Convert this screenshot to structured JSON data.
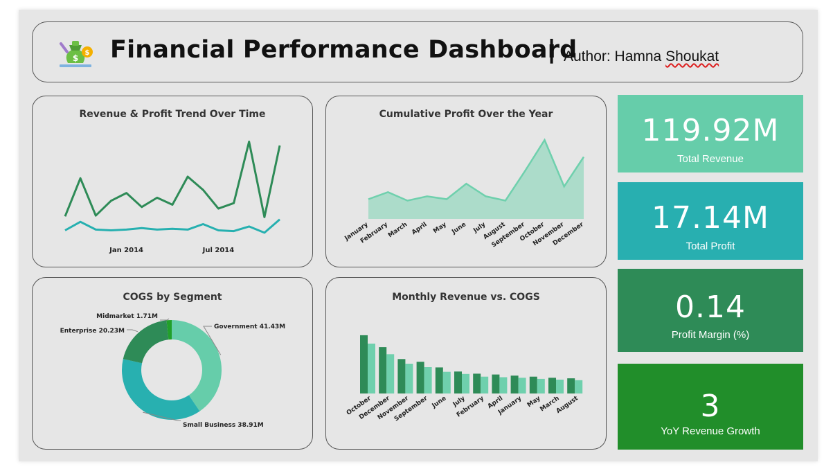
{
  "header": {
    "title": "Financial Performance Dashboard",
    "separator": "|",
    "author_prefix": "Author: Hamna ",
    "author_surname": "Shoukat"
  },
  "colors": {
    "revenue_line": "#2e8b57",
    "profit_line": "#26b0b0",
    "area_fill": "#acdcca",
    "area_line": "#6fd0ad",
    "revenue_bar": "#2e8b57",
    "cogs_bar": "#6fd0ad",
    "kpi_revenue": "#66cdaa",
    "kpi_profit": "#28afb0",
    "kpi_margin": "#2e8b57",
    "kpi_growth": "#218e2a"
  },
  "kpis": [
    {
      "value": "119.92M",
      "label": "Total Revenue"
    },
    {
      "value": "17.14M",
      "label": "Total Profit"
    },
    {
      "value": "0.14",
      "label": "Profit Margin (%)"
    },
    {
      "value": "3",
      "label": "YoY Revenue Growth"
    }
  ],
  "chart_data": [
    {
      "type": "line",
      "title": "Revenue & Profit Trend Over Time",
      "x_tick_labels": [
        "Jan 2014",
        "Jul 2014"
      ],
      "series": [
        {
          "values": [
            2.0,
            6.9,
            2.1,
            4.0,
            5.0,
            3.2,
            4.4,
            3.5,
            7.1,
            5.4,
            3.0,
            3.7,
            11.6,
            1.9,
            11.1
          ]
        },
        {
          "values": [
            0.2,
            1.3,
            0.3,
            0.2,
            0.3,
            0.5,
            0.3,
            0.4,
            0.3,
            1.0,
            0.2,
            0.1,
            0.7,
            -0.1,
            1.6
          ]
        }
      ]
    },
    {
      "type": "area",
      "title": "Cumulative Profit Over the Year",
      "categories": [
        "January",
        "February",
        "March",
        "April",
        "May",
        "June",
        "July",
        "August",
        "September",
        "October",
        "November",
        "December"
      ],
      "values": [
        1.4,
        1.9,
        1.3,
        1.6,
        1.4,
        2.5,
        1.6,
        1.3,
        3.4,
        5.6,
        2.3,
        4.4
      ]
    },
    {
      "type": "pie",
      "title": "COGS by Segment",
      "slices": [
        {
          "label": "Government",
          "value": 41.43,
          "display": "41.43M",
          "color": "#66cdaa"
        },
        {
          "label": "Small Business",
          "value": 38.91,
          "display": "38.91M",
          "color": "#28b0b0"
        },
        {
          "label": "Enterprise",
          "value": 20.23,
          "display": "20.23M",
          "color": "#2e8b57"
        },
        {
          "label": "Midmarket",
          "value": 1.71,
          "display": "1.71M",
          "color": "#21a02a"
        }
      ]
    },
    {
      "type": "bar",
      "title": "Monthly Revenue vs. COGS",
      "categories": [
        "October",
        "December",
        "November",
        "September",
        "June",
        "July",
        "February",
        "April",
        "January",
        "May",
        "March",
        "August"
      ],
      "series": [
        {
          "values": [
            21.5,
            17.1,
            12.7,
            11.7,
            9.6,
            8.1,
            7.3,
            7.0,
            6.6,
            6.2,
            5.8,
            5.6
          ]
        },
        {
          "values": [
            18.4,
            14.5,
            11.0,
            9.7,
            8.0,
            7.2,
            6.2,
            6.0,
            5.8,
            5.4,
            5.1,
            4.9
          ]
        }
      ]
    }
  ]
}
